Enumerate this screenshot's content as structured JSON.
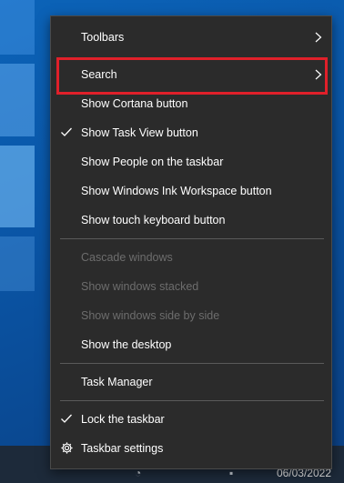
{
  "menu": {
    "items": [
      {
        "label": "Toolbars",
        "submenu": true
      },
      {
        "label": "Search",
        "submenu": true,
        "highlighted": true
      },
      {
        "label": "Show Cortana button"
      },
      {
        "label": "Show Task View button",
        "checked": true
      },
      {
        "label": "Show People on the taskbar"
      },
      {
        "label": "Show Windows Ink Workspace button"
      },
      {
        "label": "Show touch keyboard button"
      },
      {
        "label": "Cascade windows",
        "disabled": true
      },
      {
        "label": "Show windows stacked",
        "disabled": true
      },
      {
        "label": "Show windows side by side",
        "disabled": true
      },
      {
        "label": "Show the desktop"
      },
      {
        "label": "Task Manager"
      },
      {
        "label": "Lock the taskbar",
        "checked": true
      },
      {
        "label": "Taskbar settings",
        "icon": "gear-icon"
      }
    ]
  },
  "taskbar": {
    "date": "06/03/2022"
  },
  "colors": {
    "menu_bg": "#2b2b2b",
    "highlight_border": "#e0202a",
    "disabled_text": "#6d6d6d",
    "desktop_bg": "#0a55a6"
  }
}
